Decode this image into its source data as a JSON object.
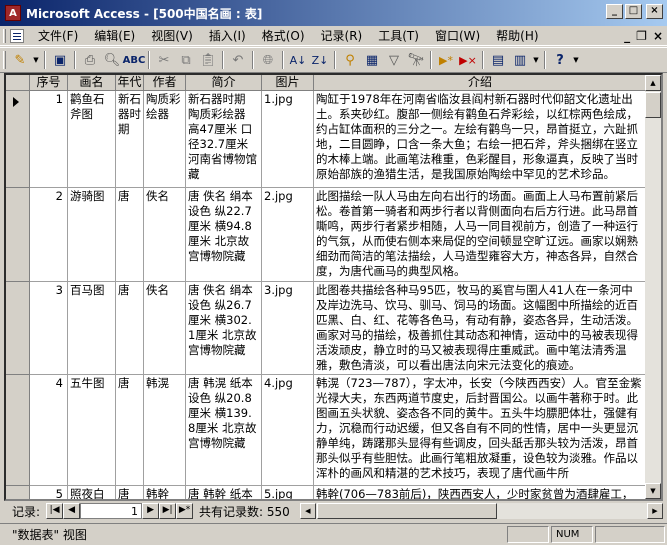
{
  "window": {
    "app_icon_letter": "A",
    "title": "Microsoft Access - [500中国名画 : 表]"
  },
  "menu": [
    "文件(F)",
    "编辑(E)",
    "视图(V)",
    "插入(I)",
    "格式(O)",
    "记录(R)",
    "工具(T)",
    "窗口(W)",
    "帮助(H)"
  ],
  "toolbar_icons": [
    "design-view-icon",
    "save-icon",
    "print-icon",
    "print-preview-icon",
    "spelling-icon",
    "cut-icon",
    "copy-icon",
    "paste-icon",
    "undo-icon",
    "hyperlink-icon",
    "sort-ascending-icon",
    "sort-descending-icon",
    "filter-by-selection-icon",
    "filter-by-form-icon",
    "apply-filter-icon",
    "find-icon",
    "new-record-icon",
    "delete-record-icon",
    "database-window-icon",
    "new-object-icon",
    "help-icon"
  ],
  "table": {
    "columns": [
      "序号",
      "画名",
      "年代",
      "作者",
      "简介",
      "图片",
      "介绍"
    ],
    "rows": [
      {
        "id": "1",
        "name": "鹳鱼石斧图",
        "era": "新石器时期",
        "author": "陶质彩绘器",
        "summary": "新石器时期 陶质彩绘器 高47厘米 口径32.7厘米 河南省博物馆藏",
        "image": "1.jpg",
        "intro": "陶缸于1978年在河南省临汝县阎村新石器时代仰韶文化遗址出土。系夹砂红。腹部一侧绘有鹳鱼石斧彩绘，以红棕两色绘成，约占缸体面积的三分之一。左绘有鹳鸟一只，昂首挺立，六趾抓地，二目圆睁，口含一条大鱼；右绘一把石斧，斧头捆绑在竖立的木棒上端。此画笔法稚重，色彩醒目，形象逼真，反映了当时原始部族的渔猎生活，是我国原始陶绘中罕见的艺术珍品。"
      },
      {
        "id": "2",
        "name": "游骑图",
        "era": "唐",
        "author": "佚名",
        "summary": "唐 佚名 绢本设色 纵22.7厘米 横94.8厘米 北京故宫博物院藏",
        "image": "2.jpg",
        "intro": "此图描绘一队人马由左向右出行的场面。画面上人马布置前紧后松。卷首第一骑者和两步行者以背侧面向右后方行进。此马昂首嘶鸣，两步行者紧步相随，人马一同目视前方，创造了一种运行的气氛，从而使右侧本来局促的空间顿显空旷辽远。画家以娴熟细劲而简洁的笔法描绘，人马造型雍容大方，神态各异，自然合度，为唐代画马的典型风格。"
      },
      {
        "id": "3",
        "name": "百马图",
        "era": "唐",
        "author": "佚名",
        "summary": "唐 佚名 绢本设色 纵26.7厘米 横302.1厘米 北京故宫博物院藏",
        "image": "3.jpg",
        "intro": "此图卷共描绘各种马95匹，牧马的奚官与圉人41人在一条河中及岸边洗马、饮马、驯马、饲马的场面。这幅图中所描绘的近百匹黑、白、红、花等各色马，有动有静，姿态各异，生动活泼。画家对马的描绘，极善抓住其动态和神情，运动中的马被表现得活泼顽皮，静立时的马又被表现得庄重威武。画中笔法清秀温雅，敷色清淡，可以看出唐法向宋元法变化的痕迹。"
      },
      {
        "id": "4",
        "name": "五牛图",
        "era": "唐",
        "author": "韩滉",
        "summary": "唐 韩滉 纸本设色 纵20.8厘米 横139.8厘米 北京故宫博物院藏",
        "image": "4.jpg",
        "intro": "韩滉（723—787），字太冲，长安（今陕西西安）人。官至金紫光禄大夫，东西两道节度史，后封晋国公。以画牛著称于时。此图画五头状貌、姿态各不同的黄牛。五头牛均膘肥体壮，强健有力，沉稳而行动迟缓，但又各自有不同的性情，居中一头更显沉静单纯，踌躇那头显得有些调皮，回头舐舌那头较为活泼，昂首那头似乎有些胆怯。此画行笔粗放凝重，设色较为淡雅。作品以浑朴的画风和精湛的艺术技巧，表现了唐代画牛所"
      },
      {
        "id": "5",
        "name": "照夜白图",
        "era": "唐",
        "author": "韩幹",
        "summary": "唐 韩幹 纸本",
        "image": "5.jpg",
        "intro": "韩幹(706—783前后)，陕西西安人，少时家贫曾为酒肆雇工，"
      }
    ]
  },
  "navigator": {
    "label": "记录:",
    "first": "|◀",
    "prev": "◀",
    "current_record": "1",
    "next": "▶",
    "last": "▶|",
    "new": "▶*",
    "count_text": "共有记录数: 550"
  },
  "status": {
    "view_text": "\"数据表\" 视图",
    "num_indicator": "NUM"
  }
}
